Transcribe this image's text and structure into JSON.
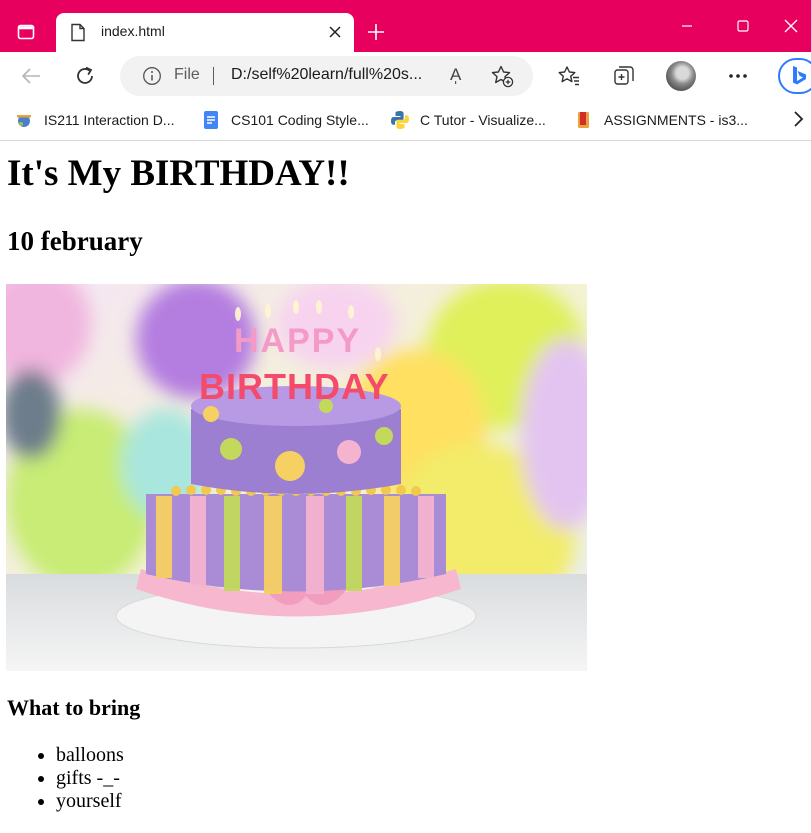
{
  "browser": {
    "tab": {
      "title": "index.html"
    },
    "address": {
      "scheme": "File",
      "url": "D:/self%20learn/full%20s..."
    },
    "read_aloud": "A̩",
    "bookmarks": [
      {
        "label": "IS211 Interaction D...",
        "icon": "web-app-icon"
      },
      {
        "label": "CS101 Coding Style...",
        "icon": "google-docs-icon"
      },
      {
        "label": "C Tutor - Visualize...",
        "icon": "python-icon"
      },
      {
        "label": "ASSIGNMENTS - is3...",
        "icon": "bookmark-book-icon"
      }
    ],
    "colors": {
      "titlebar": "#e8005f",
      "accent": "#2f7bff"
    }
  },
  "page": {
    "heading": "It's My BIRTHDAY!!",
    "date": "10 february",
    "image_alt": "Birthday cake",
    "cake_text": {
      "line1": "HAPPY",
      "line2": "BIRTHDAY"
    },
    "section_title": "What to bring",
    "items": [
      "balloons",
      "gifts -_-",
      "yourself"
    ]
  }
}
